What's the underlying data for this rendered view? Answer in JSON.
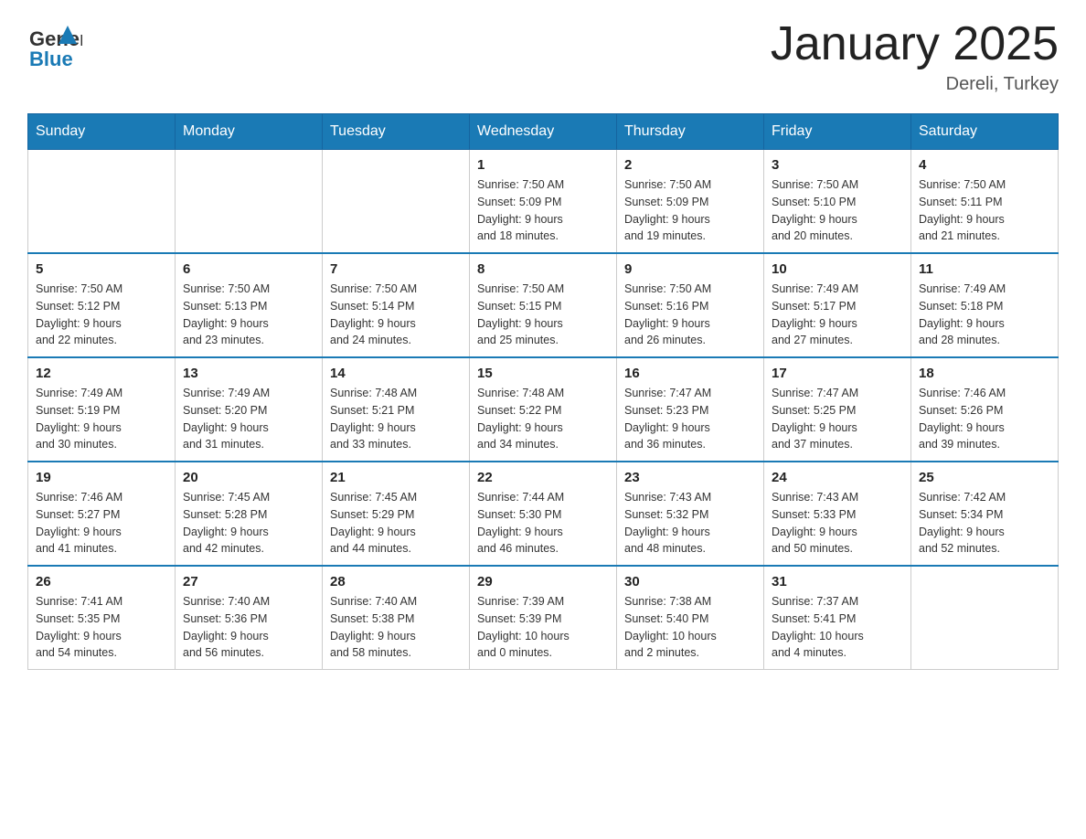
{
  "header": {
    "title": "January 2025",
    "subtitle": "Dereli, Turkey",
    "logo_general": "General",
    "logo_blue": "Blue"
  },
  "calendar": {
    "days": [
      "Sunday",
      "Monday",
      "Tuesday",
      "Wednesday",
      "Thursday",
      "Friday",
      "Saturday"
    ],
    "weeks": [
      [
        {
          "day": "",
          "info": ""
        },
        {
          "day": "",
          "info": ""
        },
        {
          "day": "",
          "info": ""
        },
        {
          "day": "1",
          "info": "Sunrise: 7:50 AM\nSunset: 5:09 PM\nDaylight: 9 hours\nand 18 minutes."
        },
        {
          "day": "2",
          "info": "Sunrise: 7:50 AM\nSunset: 5:09 PM\nDaylight: 9 hours\nand 19 minutes."
        },
        {
          "day": "3",
          "info": "Sunrise: 7:50 AM\nSunset: 5:10 PM\nDaylight: 9 hours\nand 20 minutes."
        },
        {
          "day": "4",
          "info": "Sunrise: 7:50 AM\nSunset: 5:11 PM\nDaylight: 9 hours\nand 21 minutes."
        }
      ],
      [
        {
          "day": "5",
          "info": "Sunrise: 7:50 AM\nSunset: 5:12 PM\nDaylight: 9 hours\nand 22 minutes."
        },
        {
          "day": "6",
          "info": "Sunrise: 7:50 AM\nSunset: 5:13 PM\nDaylight: 9 hours\nand 23 minutes."
        },
        {
          "day": "7",
          "info": "Sunrise: 7:50 AM\nSunset: 5:14 PM\nDaylight: 9 hours\nand 24 minutes."
        },
        {
          "day": "8",
          "info": "Sunrise: 7:50 AM\nSunset: 5:15 PM\nDaylight: 9 hours\nand 25 minutes."
        },
        {
          "day": "9",
          "info": "Sunrise: 7:50 AM\nSunset: 5:16 PM\nDaylight: 9 hours\nand 26 minutes."
        },
        {
          "day": "10",
          "info": "Sunrise: 7:49 AM\nSunset: 5:17 PM\nDaylight: 9 hours\nand 27 minutes."
        },
        {
          "day": "11",
          "info": "Sunrise: 7:49 AM\nSunset: 5:18 PM\nDaylight: 9 hours\nand 28 minutes."
        }
      ],
      [
        {
          "day": "12",
          "info": "Sunrise: 7:49 AM\nSunset: 5:19 PM\nDaylight: 9 hours\nand 30 minutes."
        },
        {
          "day": "13",
          "info": "Sunrise: 7:49 AM\nSunset: 5:20 PM\nDaylight: 9 hours\nand 31 minutes."
        },
        {
          "day": "14",
          "info": "Sunrise: 7:48 AM\nSunset: 5:21 PM\nDaylight: 9 hours\nand 33 minutes."
        },
        {
          "day": "15",
          "info": "Sunrise: 7:48 AM\nSunset: 5:22 PM\nDaylight: 9 hours\nand 34 minutes."
        },
        {
          "day": "16",
          "info": "Sunrise: 7:47 AM\nSunset: 5:23 PM\nDaylight: 9 hours\nand 36 minutes."
        },
        {
          "day": "17",
          "info": "Sunrise: 7:47 AM\nSunset: 5:25 PM\nDaylight: 9 hours\nand 37 minutes."
        },
        {
          "day": "18",
          "info": "Sunrise: 7:46 AM\nSunset: 5:26 PM\nDaylight: 9 hours\nand 39 minutes."
        }
      ],
      [
        {
          "day": "19",
          "info": "Sunrise: 7:46 AM\nSunset: 5:27 PM\nDaylight: 9 hours\nand 41 minutes."
        },
        {
          "day": "20",
          "info": "Sunrise: 7:45 AM\nSunset: 5:28 PM\nDaylight: 9 hours\nand 42 minutes."
        },
        {
          "day": "21",
          "info": "Sunrise: 7:45 AM\nSunset: 5:29 PM\nDaylight: 9 hours\nand 44 minutes."
        },
        {
          "day": "22",
          "info": "Sunrise: 7:44 AM\nSunset: 5:30 PM\nDaylight: 9 hours\nand 46 minutes."
        },
        {
          "day": "23",
          "info": "Sunrise: 7:43 AM\nSunset: 5:32 PM\nDaylight: 9 hours\nand 48 minutes."
        },
        {
          "day": "24",
          "info": "Sunrise: 7:43 AM\nSunset: 5:33 PM\nDaylight: 9 hours\nand 50 minutes."
        },
        {
          "day": "25",
          "info": "Sunrise: 7:42 AM\nSunset: 5:34 PM\nDaylight: 9 hours\nand 52 minutes."
        }
      ],
      [
        {
          "day": "26",
          "info": "Sunrise: 7:41 AM\nSunset: 5:35 PM\nDaylight: 9 hours\nand 54 minutes."
        },
        {
          "day": "27",
          "info": "Sunrise: 7:40 AM\nSunset: 5:36 PM\nDaylight: 9 hours\nand 56 minutes."
        },
        {
          "day": "28",
          "info": "Sunrise: 7:40 AM\nSunset: 5:38 PM\nDaylight: 9 hours\nand 58 minutes."
        },
        {
          "day": "29",
          "info": "Sunrise: 7:39 AM\nSunset: 5:39 PM\nDaylight: 10 hours\nand 0 minutes."
        },
        {
          "day": "30",
          "info": "Sunrise: 7:38 AM\nSunset: 5:40 PM\nDaylight: 10 hours\nand 2 minutes."
        },
        {
          "day": "31",
          "info": "Sunrise: 7:37 AM\nSunset: 5:41 PM\nDaylight: 10 hours\nand 4 minutes."
        },
        {
          "day": "",
          "info": ""
        }
      ]
    ]
  }
}
